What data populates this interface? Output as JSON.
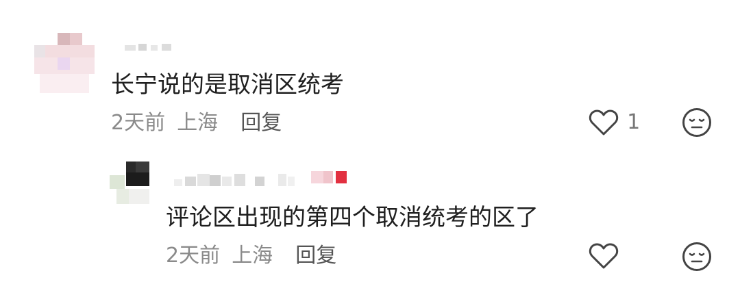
{
  "comments": [
    {
      "text": "长宁说的是取消区统考",
      "time": "2天前",
      "location": "上海",
      "reply_label": "回复",
      "like_count": "1"
    },
    {
      "text": "评论区出现的第四个取消统考的区了",
      "time": "2天前",
      "location": "上海",
      "reply_label": "回复",
      "like_count": ""
    }
  ],
  "icons": {
    "like": "heart-outline-icon",
    "dislike": "neutral-face-icon"
  },
  "colors": {
    "text": "#1f1f1f",
    "meta": "#8a8a8a",
    "icon": "#444444",
    "background": "#ffffff"
  }
}
